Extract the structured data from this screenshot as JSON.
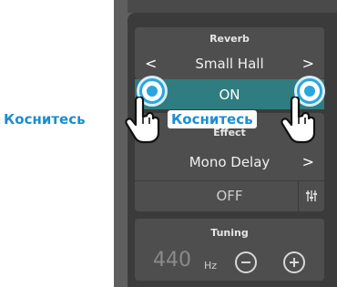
{
  "reverb": {
    "title": "Reverb",
    "type_value": "Small Hall",
    "prev_arrow": "<",
    "next_arrow": ">",
    "state": "ON"
  },
  "effect": {
    "title": "Effect",
    "type_value": "Mono Delay",
    "next_arrow": ">",
    "state": "OFF",
    "settings_icon": "sliders-icon"
  },
  "tuning": {
    "title": "Tuning",
    "value": "440",
    "unit": "Hz",
    "minus_icon": "minus-circle-icon",
    "plus_icon": "plus-circle-icon"
  },
  "annotations": {
    "touch_label_left": "Коснитесь",
    "touch_label_right": "Коснитесь"
  },
  "colors": {
    "accent": "#2f7d80",
    "touch": "#2aa6dd",
    "label": "#1a8ed0"
  }
}
